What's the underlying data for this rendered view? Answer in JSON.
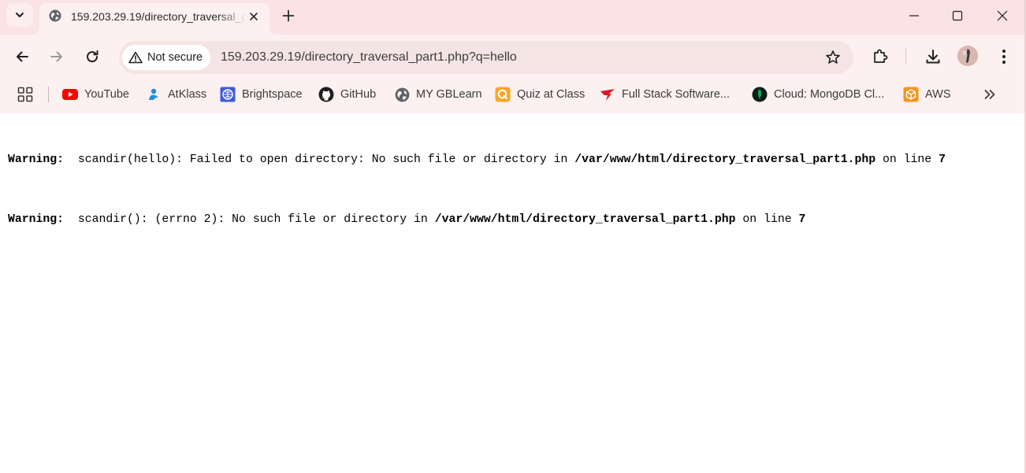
{
  "browser": {
    "tab": {
      "title": "159.203.29.19/directory_traversal_part1.php?q=hello",
      "favicon": "globe-icon"
    },
    "toolbar": {
      "security_label": "Not secure",
      "url": "159.203.29.19/directory_traversal_part1.php?q=hello"
    },
    "window_controls": [
      "minimize-icon",
      "maximize-icon",
      "close-icon"
    ],
    "bookmarks": [
      {
        "label": "YouTube",
        "icon": "youtube-icon"
      },
      {
        "label": "AtKlass",
        "icon": "atklass-icon"
      },
      {
        "label": "Brightspace",
        "icon": "brightspace-icon"
      },
      {
        "label": "GitHub",
        "icon": "github-icon"
      },
      {
        "label": "MY GBLearn",
        "icon": "globe-icon"
      },
      {
        "label": "Quiz at Class",
        "icon": "quiz-icon"
      },
      {
        "label": "Full Stack Software...",
        "icon": "fullstack-icon"
      },
      {
        "label": "Cloud: MongoDB Cl...",
        "icon": "mongodb-icon"
      },
      {
        "label": "AWS",
        "icon": "aws-icon"
      }
    ]
  },
  "page": {
    "warnings": [
      {
        "label": "Warning",
        "message": "scandir(hello): Failed to open directory: No such file or directory in",
        "file": "/var/www/html/directory_traversal_part1.php",
        "on_line": "on line",
        "line": "7"
      },
      {
        "label": "Warning",
        "message": "scandir(): (errno 2): No such file or directory in",
        "file": "/var/www/html/directory_traversal_part1.php",
        "on_line": "on line",
        "line": "7"
      }
    ]
  },
  "colors": {
    "tabstrip_bg": "#fbe3e3",
    "toolbar_bg": "#fdf0f0",
    "omnibox_bg": "#f5e4e4",
    "youtube_red": "#ff0000",
    "aws_orange": "#f7941d",
    "mongodb_green": "#00684a"
  }
}
